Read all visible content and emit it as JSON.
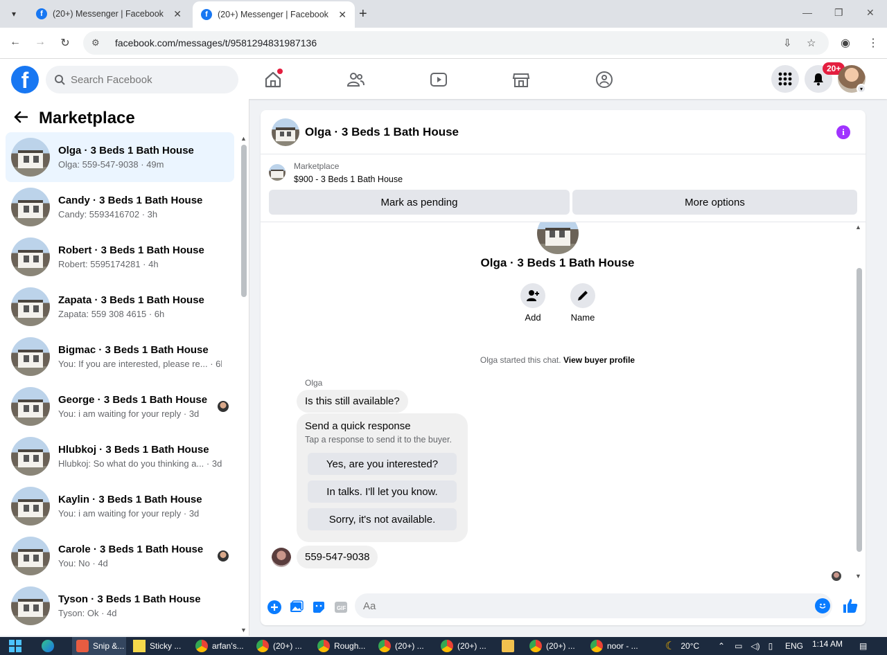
{
  "browser": {
    "tabs": [
      {
        "title": "(20+) Messenger | Facebook",
        "active": false
      },
      {
        "title": "(20+) Messenger | Facebook",
        "active": true
      }
    ],
    "url": "facebook.com/messages/t/9581294831987136"
  },
  "header": {
    "logo": "f",
    "search_placeholder": "Search Facebook",
    "notification_badge": "20+",
    "nav_icons": [
      "home-icon",
      "friends-icon",
      "video-icon",
      "marketplace-icon",
      "groups-icon"
    ]
  },
  "left": {
    "title": "Marketplace",
    "conversations": [
      {
        "name": "Olga · 3 Beds 1 Bath House",
        "sub": "Olga: 559-547-9038 · 49m",
        "active": true,
        "has_avatar": false
      },
      {
        "name": "Candy · 3 Beds 1 Bath House",
        "sub": "Candy: 5593416702 · 3h",
        "active": false,
        "has_avatar": false
      },
      {
        "name": "Robert · 3 Beds 1 Bath House",
        "sub": "Robert: 5595174281 · 4h",
        "active": false,
        "has_avatar": false
      },
      {
        "name": "Zapata · 3 Beds 1 Bath House",
        "sub": "Zapata: 559 308 4615 · 6h",
        "active": false,
        "has_avatar": false
      },
      {
        "name": "Bigmac · 3 Beds 1 Bath House",
        "sub": "You: If you are interested, please re... · 6h",
        "active": false,
        "has_avatar": false
      },
      {
        "name": "George · 3 Beds 1 Bath House",
        "sub": "You: i am waiting for your reply · 3d",
        "active": false,
        "has_avatar": true
      },
      {
        "name": "Hlubkoj · 3 Beds 1 Bath House",
        "sub": "Hlubkoj: So what do you thinking a... · 3d",
        "active": false,
        "has_avatar": false
      },
      {
        "name": "Kaylin · 3 Beds 1 Bath House",
        "sub": "You: i am waiting for your reply · 3d",
        "active": false,
        "has_avatar": false
      },
      {
        "name": "Carole · 3 Beds 1 Bath House",
        "sub": "You: No · 4d",
        "active": false,
        "has_avatar": true
      },
      {
        "name": "Tyson · 3 Beds 1 Bath House",
        "sub": "Tyson: Ok · 4d",
        "active": false,
        "has_avatar": false
      }
    ]
  },
  "chat": {
    "title": "Olga · 3 Beds 1 Bath House",
    "listing_label": "Marketplace",
    "listing_price": "$900 - 3 Beds 1 Bath House",
    "mark_pending": "Mark as pending",
    "more_options": "More options",
    "hero_name": "Olga · 3 Beds 1 Bath House",
    "action_add": "Add",
    "action_name": "Name",
    "started_text": "Olga started this chat.",
    "view_profile": "View buyer profile",
    "sender": "Olga",
    "message_1": "Is this still available?",
    "quick_title": "Send a quick response",
    "quick_sub": "Tap a response to send it to the buyer.",
    "quick_replies": [
      "Yes, are you interested?",
      "In talks. I'll let you know.",
      "Sorry, it's not available."
    ],
    "message_2": "559-547-9038",
    "composer_placeholder": "Aa"
  },
  "taskbar": {
    "items": [
      "Snip &...",
      "Sticky ...",
      "arfan's...",
      "(20+) ...",
      "Rough...",
      "(20+) ...",
      "(20+) ...",
      "(20+) ...",
      "noor - ..."
    ],
    "weather": "20°C",
    "lang": "ENG",
    "time": "1:14 AM"
  }
}
